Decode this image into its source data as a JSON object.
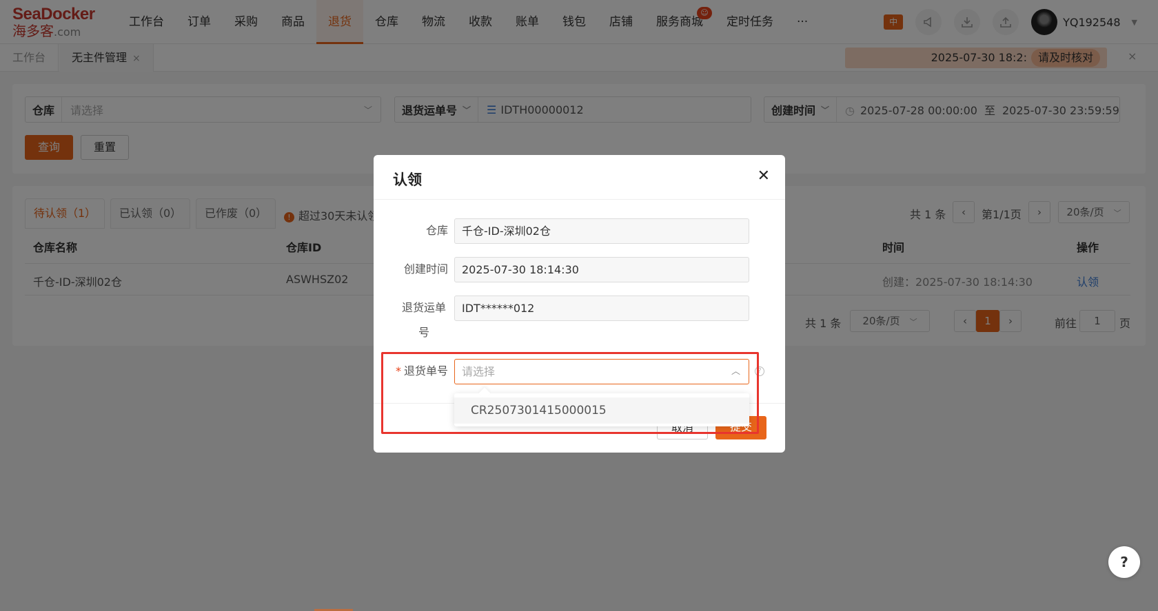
{
  "brand": {
    "logo_top": "SeaDocker",
    "logo_cn": "海多客",
    "logo_com": ".com"
  },
  "nav": {
    "items": [
      {
        "label": "工作台"
      },
      {
        "label": "订单"
      },
      {
        "label": "采购"
      },
      {
        "label": "商品"
      },
      {
        "label": "退货",
        "active": true
      },
      {
        "label": "仓库"
      },
      {
        "label": "物流"
      },
      {
        "label": "收款"
      },
      {
        "label": "账单"
      },
      {
        "label": "钱包"
      },
      {
        "label": "店铺"
      },
      {
        "label": "服务商城",
        "badge": "hot"
      },
      {
        "label": "定时任务"
      },
      {
        "label": "···"
      }
    ],
    "lang": "中",
    "username": "YQ192548"
  },
  "page_tabs": [
    {
      "label": "工作台"
    },
    {
      "label": "无主件管理",
      "close": "×"
    }
  ],
  "notice": {
    "text": "2025-07-30 18:2:",
    "tip": "请及时核对",
    "close": "×"
  },
  "filters": {
    "warehouse_label": "仓库",
    "warehouse_placeholder": "请选择",
    "waybill_label": "退货运单号",
    "waybill_value": "IDTH00000012",
    "time_label": "创建时间",
    "time_start": "2025-07-28 00:00:00",
    "time_sep": "至",
    "time_end": "2025-07-30 23:59:59",
    "query_btn": "查询",
    "reset_btn": "重置"
  },
  "status_tabs": [
    {
      "label": "待认领（1）"
    },
    {
      "label": "已认领（0）"
    },
    {
      "label": "已作废（0）"
    }
  ],
  "warning_text": "超过30天未认领",
  "top_pager": {
    "total": "共 1 条",
    "page": "第1/1页",
    "size": "20条/页"
  },
  "table": {
    "headers": [
      "仓库名称",
      "仓库ID",
      "时间",
      "操作"
    ],
    "rows": [
      {
        "name": "千仓-ID-深圳02仓",
        "id": "ASWHSZ02",
        "time": "创建：2025-07-30 18:14:30",
        "action": "认领"
      }
    ]
  },
  "bottom_pager": {
    "total": "共 1 条",
    "size": "20条/页",
    "current": "1",
    "goto_label": "前往",
    "goto_value": "1",
    "page_unit": "页"
  },
  "modal": {
    "title": "认领",
    "close": "✕",
    "fields": [
      {
        "label": "仓库",
        "value": "千仓-ID-深圳02仓"
      },
      {
        "label": "创建时间",
        "value": "2025-07-30 18:14:30"
      },
      {
        "label": "退货运单号",
        "value": "IDT******012"
      }
    ],
    "order_label": "退货单号",
    "order_placeholder": "请选择",
    "dropdown_options": [
      "CR2507301415000015"
    ],
    "cancel_btn": "取消",
    "submit_btn": "提交"
  },
  "help_btn": "?",
  "colors": {
    "accent": "#e8651a",
    "highlight": "#e8352e",
    "link": "#3a7bd5"
  }
}
